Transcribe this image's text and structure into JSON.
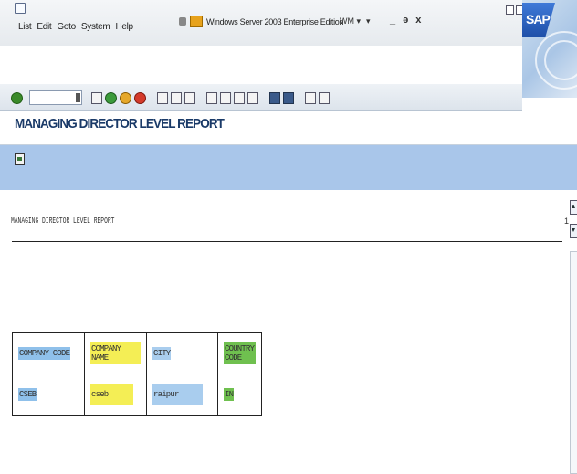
{
  "menu": [
    "List",
    "Edit",
    "Goto",
    "System",
    "Help"
  ],
  "taskbar": {
    "title": "Windows Server 2003 Enterprise Edition",
    "lang": "WM ▾",
    "mic": "▾"
  },
  "window_controls": [
    "_",
    "ə",
    "x"
  ],
  "brand": "SAP",
  "page_title": "MANAGING DIRECTOR LEVEL REPORT",
  "report": {
    "heading": "MANAGING DIRECTOR LEVEL REPORT",
    "page": "1",
    "columns": [
      {
        "label": "COMPANY CODE",
        "color": "#8fc0ea"
      },
      {
        "label": "COMPANY NAME",
        "color": "#f4ee55"
      },
      {
        "label": "CITY",
        "color": "#a9cdee"
      },
      {
        "label": "COUNTRY CODE",
        "color": "#6fc04f"
      }
    ],
    "row": [
      {
        "value": "CSEB",
        "color": "#8fc0ea"
      },
      {
        "value": "cseb",
        "color": "#f4ee55"
      },
      {
        "value": "raipur",
        "color": "#a9cdee"
      },
      {
        "value": "IN",
        "color": "#6fc04f"
      }
    ]
  }
}
